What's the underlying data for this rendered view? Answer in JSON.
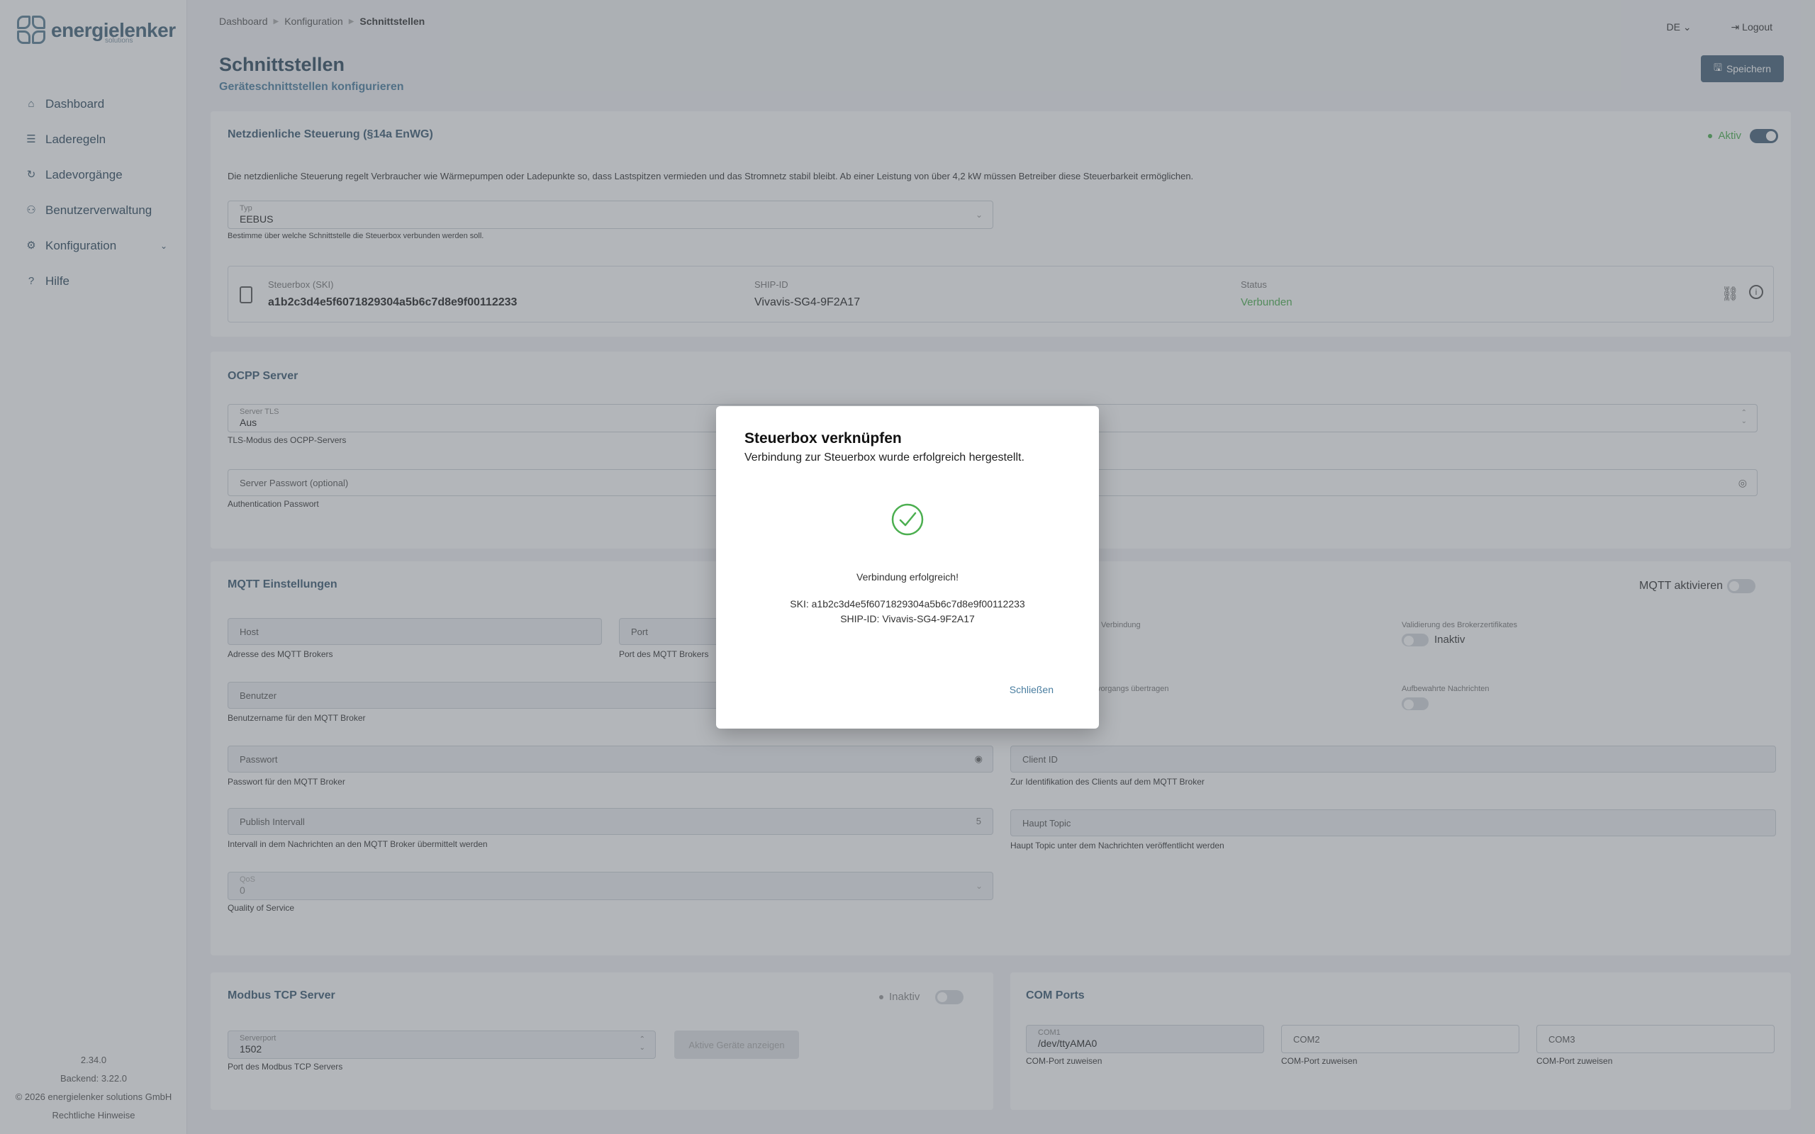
{
  "brand": {
    "name": "energielenker",
    "sub": "solutions"
  },
  "sidebar": {
    "items": [
      {
        "label": "Dashboard",
        "icon": "home-icon"
      },
      {
        "label": "Laderegeln",
        "icon": "rules-icon"
      },
      {
        "label": "Ladevorgänge",
        "icon": "charge-icon"
      },
      {
        "label": "Benutzerverwaltung",
        "icon": "users-icon"
      },
      {
        "label": "Konfiguration",
        "icon": "gear-icon"
      },
      {
        "label": "Hilfe",
        "icon": "help-icon"
      }
    ],
    "footer": {
      "version": "2.34.0",
      "backend": "Backend: 3.22.0",
      "copyright": "© 2026 energielenker solutions GmbH",
      "legal": "Rechtliche Hinweise"
    }
  },
  "breadcrumb": [
    "Dashboard",
    "Konfiguration",
    "Schnittstellen"
  ],
  "header": {
    "language": "DE",
    "logout": "Logout",
    "title": "Schnittstellen",
    "subtitle": "Geräteschnittstellen konfigurieren",
    "save": "Speichern"
  },
  "netz": {
    "title": "Netzdienliche Steuerung (§14a EnWG)",
    "status": "Aktiv",
    "description": "Die netzdienliche Steuerung regelt Verbraucher wie Wärmepumpen oder Ladepunkte so, dass Lastspitzen vermieden und das Stromnetz stabil bleibt. Ab einer Leistung von über 4,2 kW müssen Betreiber diese Steuerbarkeit ermöglichen.",
    "type_label": "Typ",
    "type_value": "EEBUS",
    "type_help": "Bestimme über welche Schnittstelle die Steuerbox verbunden werden soll.",
    "ski_label": "Steuerbox (SKI)",
    "ski_value": "a1b2c3d4e5f6071829304a5b6c7d8e9f00112233",
    "ship_label": "SHIP-ID",
    "ship_value": "Vivavis-SG4-9F2A17",
    "status_label": "Status",
    "status_value": "Verbunden"
  },
  "ocpp": {
    "title": "OCPP Server",
    "tls_label": "Server TLS",
    "tls_value": "Aus",
    "tls_help": "TLS-Modus des OCPP-Servers",
    "pw_placeholder": "Server Passwort (optional)",
    "pw_help": "Authentication Passwort"
  },
  "mqtt": {
    "title": "MQTT Einstellungen",
    "toggle_label": "MQTT aktivieren",
    "host": "Host",
    "host_help": "Adresse des MQTT Brokers",
    "port": "Port",
    "port_help": "Port des MQTT Brokers",
    "ssl_caption": "Verbindung",
    "cert_caption": "Validierung des Brokerzertifikates",
    "cert_state": "Inaktiv",
    "transfer_caption": "vorgangs übertragen",
    "retained_caption": "Aufbewahrte Nachrichten",
    "user": "Benutzer",
    "user_help": "Benutzername für den MQTT Broker",
    "password": "Passwort",
    "password_help": "Passwort für den MQTT Broker",
    "client": "Client ID",
    "client_help": "Zur Identifikation des Clients auf dem MQTT Broker",
    "interval": "Publish Intervall",
    "interval_value": "5",
    "interval_help": "Intervall in dem Nachrichten an den MQTT Broker übermittelt werden",
    "topic": "Haupt Topic",
    "topic_help": "Haupt Topic unter dem Nachrichten veröffentlicht werden",
    "qos_label": "QoS",
    "qos_value": "0",
    "qos_help": "Quality of Service"
  },
  "modbus": {
    "title": "Modbus TCP Server",
    "status": "Inaktiv",
    "port_label": "Serverport",
    "port_value": "1502",
    "port_help": "Port des Modbus TCP Servers",
    "devices_button": "Aktive Geräte anzeigen"
  },
  "com": {
    "title": "COM Ports",
    "com1_label": "COM1",
    "com1_value": "/dev/ttyAMA0",
    "com2": "COM2",
    "com3": "COM3",
    "help": "COM-Port zuweisen"
  },
  "dialog": {
    "title": "Steuerbox verknüpfen",
    "subtitle": "Verbindung zur Steuerbox wurde erfolgreich hergestellt.",
    "success": "Verbindung erfolgreich!",
    "ski": "SKI: a1b2c3d4e5f6071829304a5b6c7d8e9f00112233",
    "ship": "SHIP-ID: Vivavis-SG4-9F2A17",
    "close": "Schließen"
  },
  "colors": {
    "accent": "#46637a",
    "link": "#4a7ea0",
    "success": "#4caf50"
  }
}
